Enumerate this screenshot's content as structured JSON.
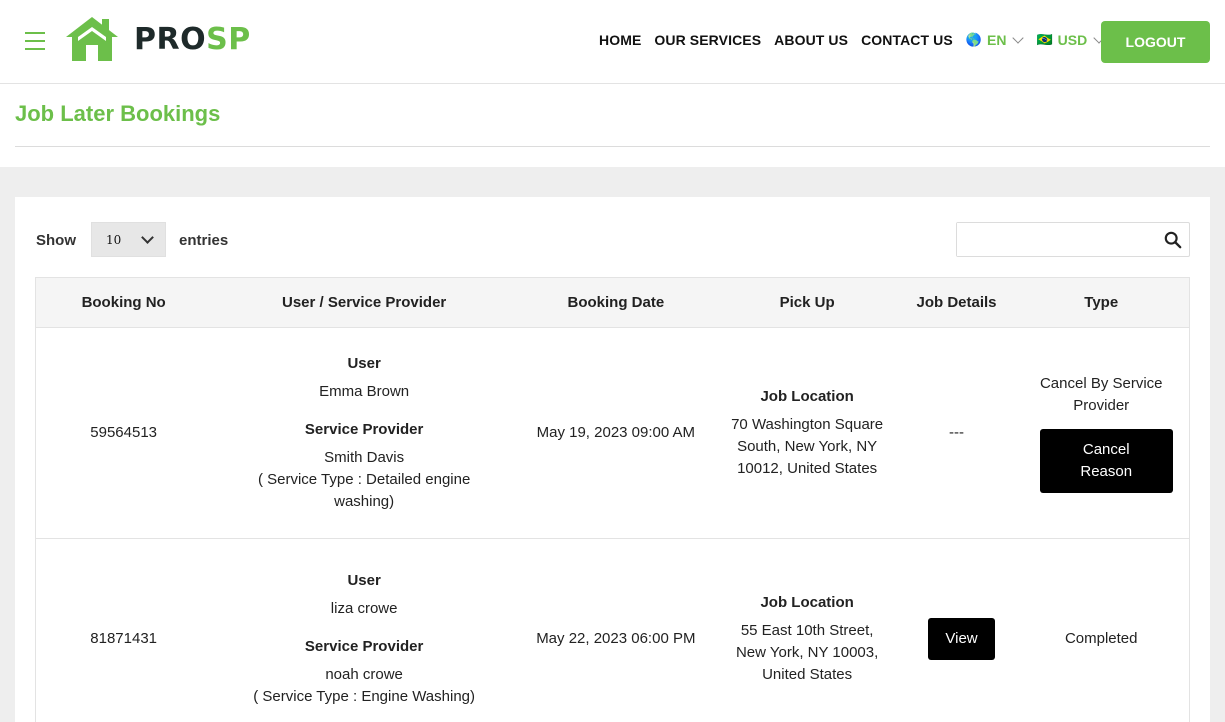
{
  "header": {
    "logo_pro": "PRO",
    "logo_sp": "SP",
    "nav": [
      "HOME",
      "OUR SERVICES",
      "ABOUT US",
      "CONTACT US"
    ],
    "language": "EN",
    "language_icon": "globe-icon",
    "currency": "USD",
    "currency_icon": "flag-icon",
    "logout_label": "LOGOUT"
  },
  "colors": {
    "accent": "#6cbf4a",
    "dark_button": "#000000"
  },
  "page": {
    "title": "Job Later Bookings"
  },
  "table_controls": {
    "show_label": "Show",
    "entries_value": "10",
    "entries_label": "entries",
    "search_value": ""
  },
  "table": {
    "headers": [
      "Booking No",
      "User / Service Provider",
      "Booking Date",
      "Pick Up",
      "Job Details",
      "Type"
    ],
    "rows": [
      {
        "booking_no": "59564513",
        "user_label": "User",
        "user": "Emma Brown",
        "provider_label": "Service Provider",
        "provider": "Smith Davis",
        "service_type": "( Service Type : Detailed engine washing)",
        "booking_date": "May 19, 2023 09:00 AM",
        "pickup_label": "Job Location",
        "pickup": "70 Washington Square South, New York, NY 10012, United States",
        "job_details": "---",
        "type": "Cancel By Service Provider",
        "action": "Cancel Reason"
      },
      {
        "booking_no": "81871431",
        "user_label": "User",
        "user": "liza crowe",
        "provider_label": "Service Provider",
        "provider": "noah crowe",
        "service_type": "( Service Type : Engine Washing)",
        "booking_date": "May 22, 2023 06:00 PM",
        "pickup_label": "Job Location",
        "pickup": "55 East 10th Street, New York, NY 10003, United States",
        "job_details": "View",
        "type": "Completed"
      }
    ]
  }
}
